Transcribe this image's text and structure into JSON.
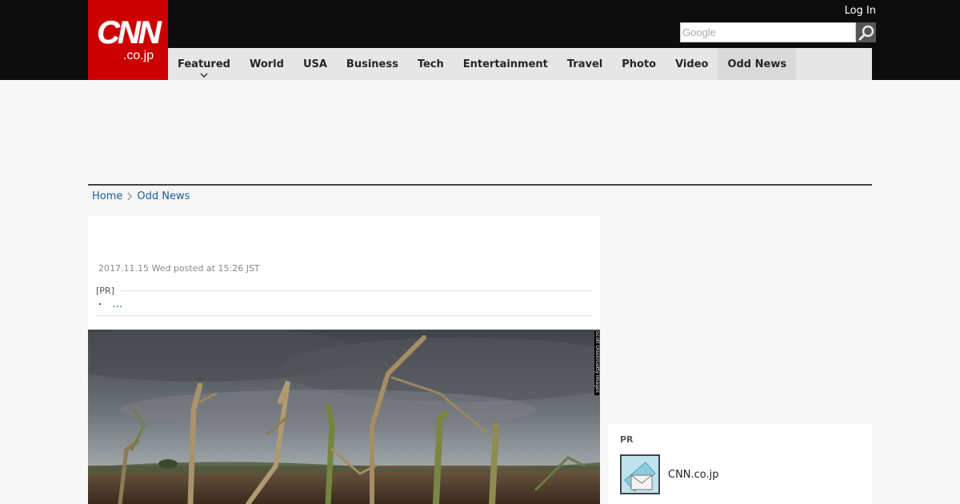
{
  "header": {
    "logo_main": "CNN",
    "logo_sub": ".co.jp",
    "login_label": "Log In",
    "search": {
      "placeholder": "Google",
      "value": ""
    }
  },
  "nav": {
    "items": [
      {
        "label": "Featured",
        "has_dropdown": true
      },
      {
        "label": "World"
      },
      {
        "label": "USA"
      },
      {
        "label": "Business"
      },
      {
        "label": "Tech"
      },
      {
        "label": "Entertainment"
      },
      {
        "label": "Travel"
      },
      {
        "label": "Photo"
      },
      {
        "label": "Video"
      },
      {
        "label": "Odd News",
        "active": true
      }
    ]
  },
  "breadcrumb": {
    "home": "Home",
    "current": "Odd News"
  },
  "article": {
    "posted": "2017.11.15 Wed posted at 15:26 JST",
    "pr_label": "[PR]",
    "pr_bullet": "・",
    "pr_link": "…",
    "photo_credit": "Scott Olson/Getty Images"
  },
  "sidebar": {
    "pr_label": "PR",
    "pr_item_label": "CNN.co.jp"
  },
  "colors": {
    "brand_red": "#cc0000",
    "topbar": "#0c0c0c",
    "link": "#1a5d9a"
  }
}
